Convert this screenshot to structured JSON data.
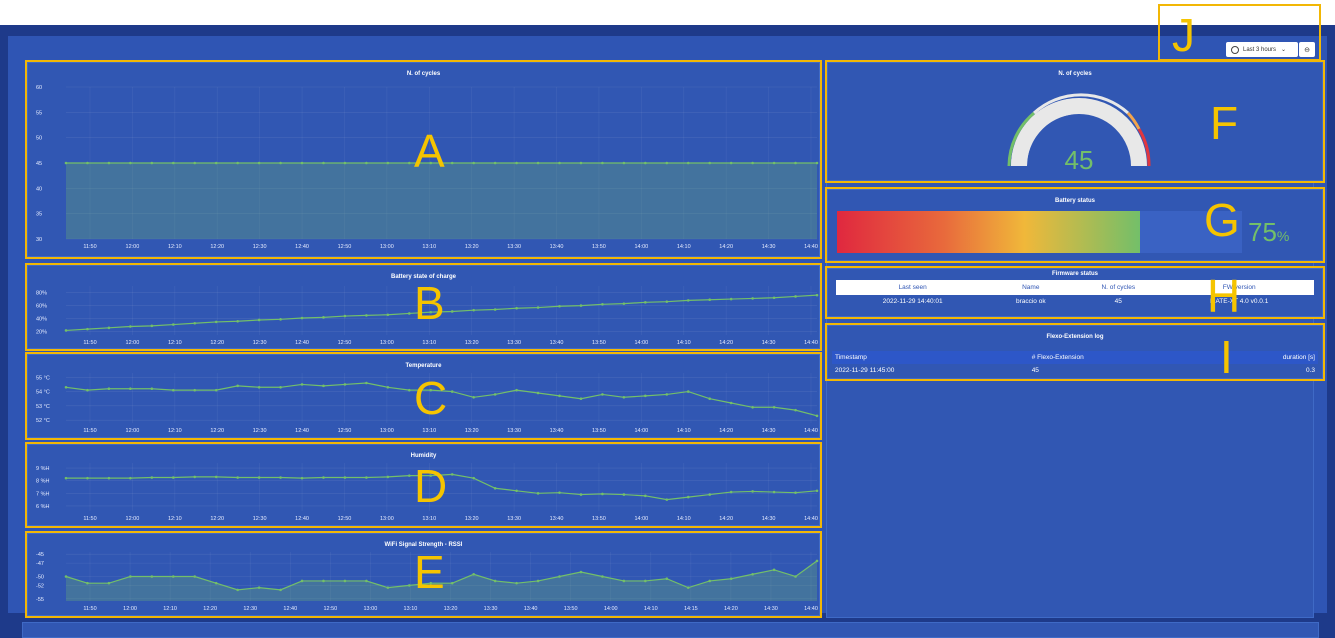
{
  "toolbar": {
    "time_range_label": "Last 3 hours",
    "time_icon": "clock-icon",
    "chevron_icon": "chevron-down-icon",
    "zoom_icon": "zoom-out-icon"
  },
  "annotations": {
    "A": "A",
    "B": "B",
    "C": "C",
    "D": "D",
    "E": "E",
    "F": "F",
    "G": "G",
    "H": "H",
    "I": "I",
    "J": "J"
  },
  "colors": {
    "accent_yellow": "#f2b705",
    "series_green": "#73bf69",
    "panel_bg": "#3157b3"
  },
  "cycles_gauge": {
    "title": "N. of cycles",
    "value": "45",
    "fraction": 0.45
  },
  "battery": {
    "title": "Battery status",
    "value": "75",
    "unit": "%",
    "fraction": 0.75
  },
  "firmware": {
    "title": "Firmware status",
    "headers": [
      "Last seen",
      "Name",
      "N. of cycles",
      "FW version"
    ],
    "rows": [
      [
        "2022-11-29 14:40:01",
        "braccio ok",
        "45",
        "MATE-XT 4.0 v0.0.1"
      ]
    ]
  },
  "flexo_log": {
    "title": "Flexo-Extension log",
    "headers": [
      "Timestamp",
      "# Flexo-Extension",
      "duration [s]"
    ],
    "rows": [
      [
        "2022-11-29 11:45:00",
        "45",
        "0.3"
      ]
    ]
  },
  "chart_data": [
    {
      "id": "cycles",
      "type": "area",
      "title": "N. of cycles",
      "xlabel": "",
      "ylabel": "",
      "x_ticks": [
        "11:50",
        "12:00",
        "12:10",
        "12:20",
        "12:30",
        "12:40",
        "12:50",
        "13:00",
        "13:10",
        "13:20",
        "13:30",
        "13:40",
        "13:50",
        "14:00",
        "14:10",
        "14:20",
        "14:30",
        "14:40"
      ],
      "y_ticks": [
        "30",
        "35",
        "40",
        "45",
        "50",
        "55",
        "60"
      ],
      "ylim": [
        30,
        60
      ],
      "x": [
        11.75,
        12.0,
        12.25,
        12.5,
        12.75,
        13.0,
        13.25,
        13.5,
        13.75,
        14.0,
        14.25,
        14.5,
        14.75,
        15.0,
        15.25,
        15.5,
        15.75,
        16.0,
        16.25,
        16.5,
        16.75,
        17.0,
        17.25,
        17.5,
        17.75,
        18.0,
        18.25,
        18.5,
        18.75,
        19.0,
        19.25,
        19.5,
        19.75,
        20.0,
        20.25,
        20.5
      ],
      "values": [
        45,
        45,
        45,
        45,
        45,
        45,
        45,
        45,
        45,
        45,
        45,
        45,
        45,
        45,
        45,
        45,
        45,
        45,
        45,
        45,
        45,
        45,
        45,
        45,
        45,
        45,
        45,
        45,
        45,
        45,
        45,
        45,
        45,
        45,
        45,
        45
      ],
      "grid": true
    },
    {
      "id": "battery_soc",
      "type": "line",
      "title": "Battery state of charge",
      "xlabel": "",
      "ylabel": "",
      "x_ticks": [
        "11:50",
        "12:00",
        "12:10",
        "12:20",
        "12:30",
        "12:40",
        "12:50",
        "13:00",
        "13:10",
        "13:20",
        "13:30",
        "13:40",
        "13:50",
        "14:00",
        "14:10",
        "14:20",
        "14:30",
        "14:40"
      ],
      "y_ticks": [
        "20%",
        "40%",
        "60%",
        "80%"
      ],
      "ylim": [
        15,
        90
      ],
      "values": [
        22,
        24,
        26,
        28,
        29,
        31,
        33,
        35,
        36,
        38,
        39,
        41,
        42,
        44,
        45,
        46,
        48,
        50,
        51,
        53,
        54,
        56,
        57,
        59,
        60,
        62,
        63,
        65,
        66,
        68,
        69,
        70,
        71,
        72,
        74,
        76
      ],
      "grid": true
    },
    {
      "id": "temperature",
      "type": "line",
      "title": "Temperature",
      "xlabel": "",
      "ylabel": "",
      "x_ticks": [
        "11:50",
        "12:00",
        "12:10",
        "12:20",
        "12:30",
        "12:40",
        "12:50",
        "13:00",
        "13:10",
        "13:20",
        "13:30",
        "13:40",
        "13:50",
        "14:00",
        "14:10",
        "14:20",
        "14:30",
        "14:40"
      ],
      "y_ticks": [
        "52 °C",
        "53 °C",
        "54 °C",
        "55 °C"
      ],
      "ylim": [
        51.8,
        55.3
      ],
      "values": [
        54.3,
        54.1,
        54.2,
        54.2,
        54.2,
        54.1,
        54.1,
        54.1,
        54.4,
        54.3,
        54.3,
        54.5,
        54.4,
        54.5,
        54.6,
        54.3,
        54.1,
        54.1,
        54.0,
        53.6,
        53.8,
        54.1,
        53.9,
        53.7,
        53.5,
        53.8,
        53.6,
        53.7,
        53.8,
        54.0,
        53.5,
        53.2,
        52.9,
        52.9,
        52.7,
        52.3
      ],
      "grid": true
    },
    {
      "id": "humidity",
      "type": "line",
      "title": "Humidity",
      "xlabel": "",
      "ylabel": "",
      "x_ticks": [
        "11:50",
        "12:00",
        "12:10",
        "12:20",
        "12:30",
        "12:40",
        "12:50",
        "13:00",
        "13:10",
        "13:20",
        "13:30",
        "13:40",
        "13:50",
        "14:00",
        "14:10",
        "14:20",
        "14:30",
        "14:40"
      ],
      "y_ticks": [
        "6 %H",
        "7 %H",
        "8 %H",
        "9 %H"
      ],
      "ylim": [
        5.6,
        9.4
      ],
      "values": [
        8.2,
        8.2,
        8.2,
        8.2,
        8.25,
        8.25,
        8.3,
        8.3,
        8.25,
        8.25,
        8.25,
        8.2,
        8.25,
        8.25,
        8.25,
        8.3,
        8.4,
        8.4,
        8.5,
        8.2,
        7.4,
        7.2,
        7.0,
        7.05,
        6.9,
        6.95,
        6.9,
        6.8,
        6.5,
        6.7,
        6.9,
        7.1,
        7.15,
        7.1,
        7.05,
        7.2
      ],
      "grid": true
    },
    {
      "id": "wifi_rssi",
      "type": "area",
      "title": "WiFi Signal Strength - RSSI",
      "xlabel": "",
      "ylabel": "",
      "x_ticks": [
        "11:50",
        "12:00",
        "12:10",
        "12:20",
        "12:30",
        "12:40",
        "12:50",
        "13:00",
        "13:10",
        "13:20",
        "13:30",
        "13:40",
        "13:50",
        "14:00",
        "14:10",
        "14:15",
        "14:20",
        "14:30",
        "14:40"
      ],
      "y_ticks": [
        "-45",
        "-47",
        "-50",
        "-52",
        "-55"
      ],
      "ylim": [
        -55.5,
        -44.5
      ],
      "values": [
        -50,
        -51.5,
        -51.5,
        -50,
        -50,
        -50,
        -50,
        -51.5,
        -53,
        -52.5,
        -53,
        -51,
        -51,
        -51,
        -51,
        -52.5,
        -52,
        -51.5,
        -51.5,
        -49.5,
        -51,
        -51.5,
        -51,
        -50,
        -49,
        -50,
        -51,
        -51,
        -50.5,
        -52.5,
        -51,
        -50.5,
        -49.5,
        -48.5,
        -50,
        -46.5
      ],
      "grid": true
    }
  ]
}
